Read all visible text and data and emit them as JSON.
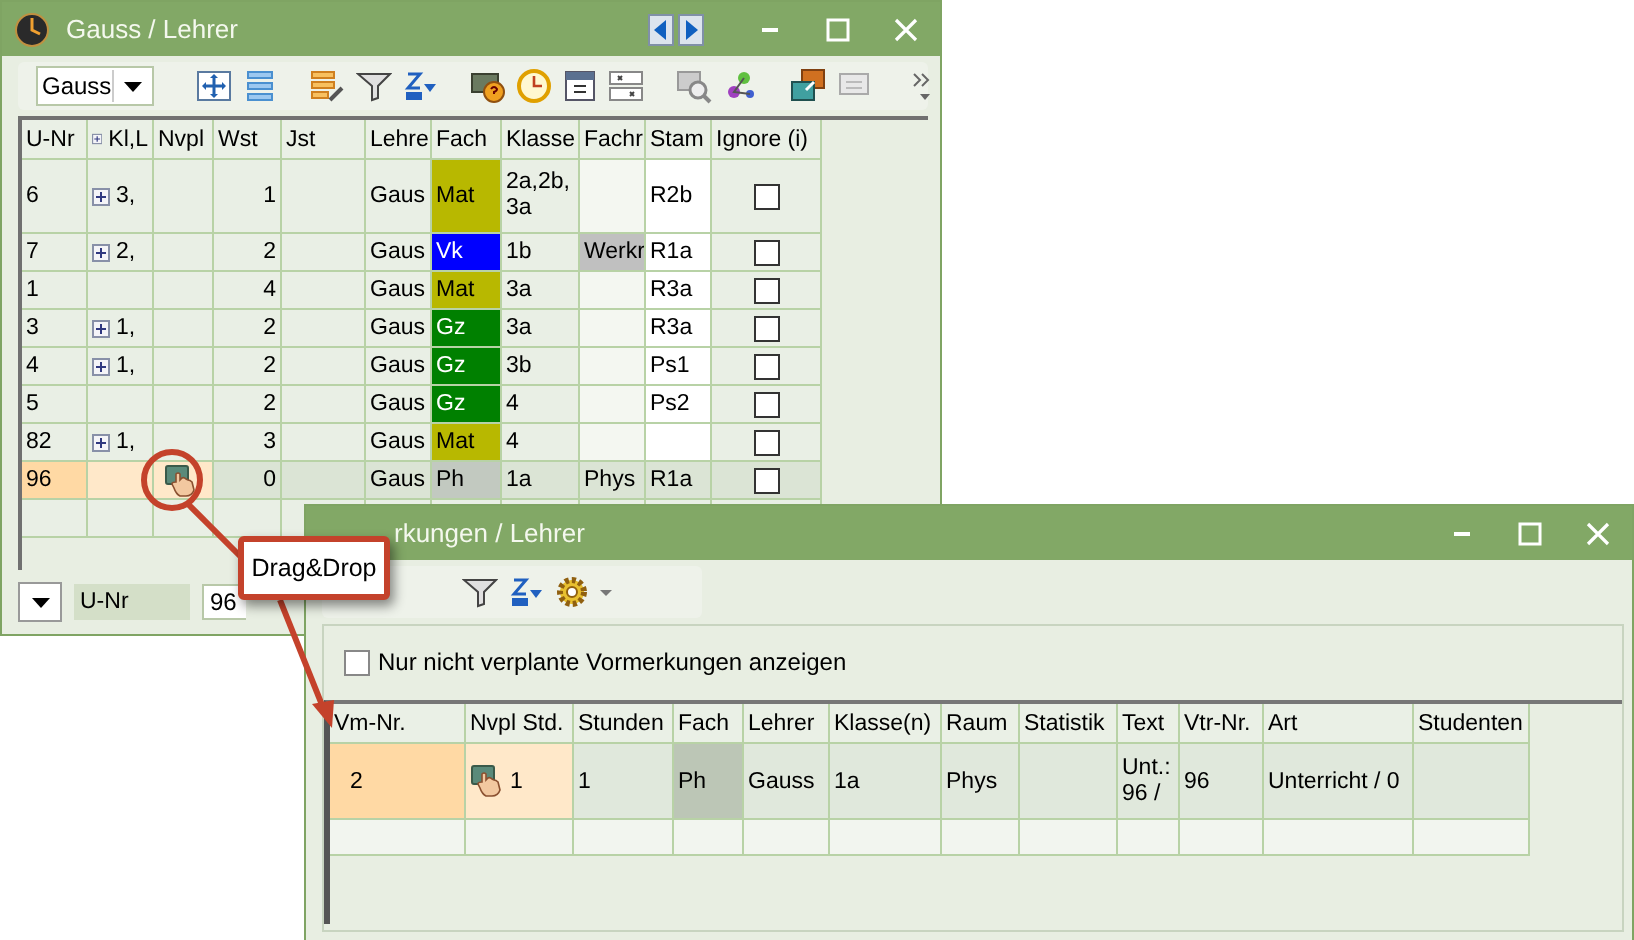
{
  "main_window": {
    "title": "Gauss / Lehrer",
    "teacher_select": {
      "value": "Gauss"
    },
    "table": {
      "columns": [
        "U-Nr",
        "Kl,L",
        "Nvpl",
        "Wst",
        "Jst",
        "Lehre",
        "Fach",
        "Klasse",
        "Fachr",
        "Stam",
        "Ignore (i)"
      ],
      "rows": [
        {
          "u_nr": "6",
          "kl": "3,",
          "wst": "1",
          "lehrer": "Gaus",
          "fach": {
            "text": "Mat",
            "color": "#b8b800"
          },
          "klassen": "2a,2b, 3a",
          "stamm": "R2b",
          "ignore": false,
          "nvpl_icon": false,
          "selected": false
        },
        {
          "u_nr": "7",
          "kl": "2,",
          "wst": "2",
          "lehrer": "Gaus",
          "fach": {
            "text": "Vk",
            "color": "#0000ff"
          },
          "klassen": "1b",
          "fachr": {
            "text": "Werkr",
            "color": "#c0c0c0"
          },
          "stamm": "R1a",
          "ignore": false,
          "nvpl_icon": false,
          "selected": false
        },
        {
          "u_nr": "1",
          "wst": "4",
          "lehrer": "Gaus",
          "fach": {
            "text": "Mat",
            "color": "#b8b800"
          },
          "klassen": "3a",
          "stamm": "R3a",
          "ignore": false,
          "nvpl_icon": false,
          "selected": false
        },
        {
          "u_nr": "3",
          "kl": "1,",
          "wst": "2",
          "lehrer": "Gaus",
          "fach": {
            "text": "Gz",
            "color": "#008000"
          },
          "klassen": "3a",
          "stamm": "R3a",
          "ignore": false,
          "nvpl_icon": false,
          "selected": false
        },
        {
          "u_nr": "4",
          "kl": "1,",
          "wst": "2",
          "lehrer": "Gaus",
          "fach": {
            "text": "Gz",
            "color": "#008000"
          },
          "klassen": "3b",
          "stamm": "Ps1",
          "ignore": false,
          "nvpl_icon": false,
          "selected": false
        },
        {
          "u_nr": "5",
          "wst": "2",
          "lehrer": "Gaus",
          "fach": {
            "text": "Gz",
            "color": "#008000"
          },
          "klassen": "4",
          "stamm": "Ps2",
          "ignore": false,
          "nvpl_icon": false,
          "selected": false
        },
        {
          "u_nr": "82",
          "kl": "1,",
          "wst": "3",
          "lehrer": "Gaus",
          "fach": {
            "text": "Mat",
            "color": "#b8b800"
          },
          "klassen": "4",
          "ignore": false,
          "nvpl_icon": false,
          "selected": false
        },
        {
          "u_nr": "96",
          "wst": "0",
          "lehrer": "Gaus",
          "fach": {
            "text": "Ph",
            "color": "#c2c9c0"
          },
          "klassen": "1a",
          "fachr": {
            "text": "Phys"
          },
          "stamm": "R1a",
          "ignore": false,
          "nvpl_icon": true,
          "selected": true
        }
      ]
    },
    "filter": {
      "label": "U-Nr",
      "value": "96"
    }
  },
  "callout": {
    "text": "Drag&Drop"
  },
  "second_window": {
    "title": "rkungen / Lehrer",
    "option": {
      "label": "Nur nicht verplante Vormerkungen anzeigen",
      "checked": false
    },
    "table": {
      "columns": [
        "Vm-Nr.",
        "Nvpl Std.",
        "Stunden",
        "Fach",
        "Lehrer",
        "Klasse(n)",
        "Raum",
        "Statistik",
        "Text",
        "Vtr-Nr.",
        "Art",
        "Studenten"
      ],
      "rows": [
        {
          "vm_nr": "2",
          "nvpl_icon": true,
          "nvpl_std": "1",
          "stunden": "1",
          "fach": {
            "text": "Ph",
            "color": "#bcc6b6"
          },
          "lehrer": "Gauss",
          "klassen": "1a",
          "raum": "Phys",
          "text": "Unt.: 96 /",
          "vtr_nr": "96",
          "art": "Unterricht / 0",
          "selected": true
        }
      ]
    }
  }
}
